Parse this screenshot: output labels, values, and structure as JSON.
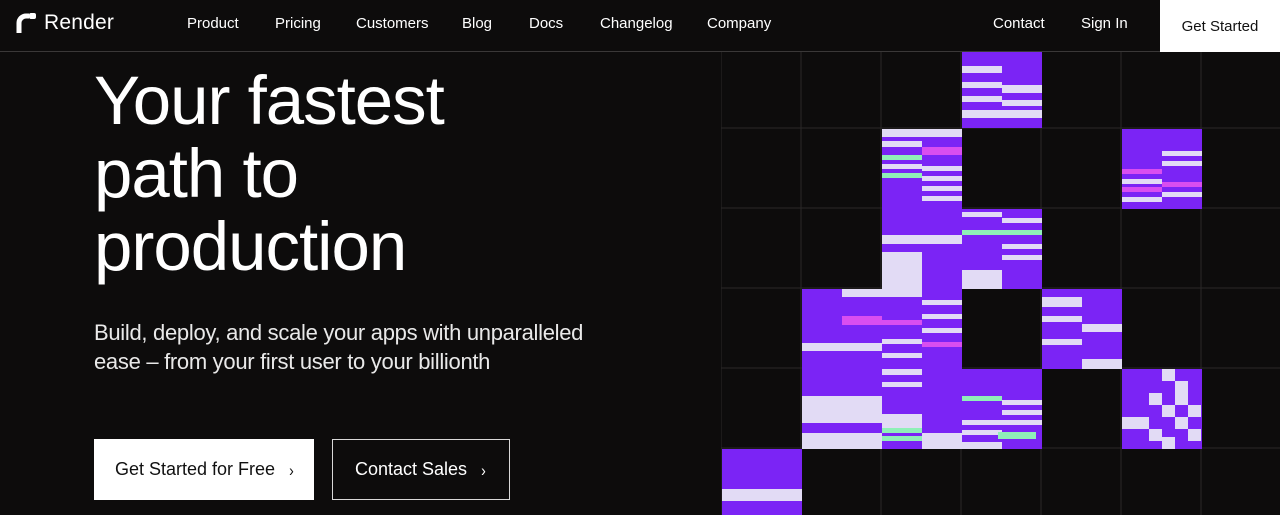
{
  "brand": {
    "name": "Render",
    "icon": "render-logo-icon"
  },
  "nav": {
    "items": [
      "Product",
      "Pricing",
      "Customers",
      "Blog",
      "Docs",
      "Changelog",
      "Company"
    ],
    "right": [
      "Contact",
      "Sign In"
    ],
    "cta": "Get Started"
  },
  "hero": {
    "title_lines": [
      "Your fastest",
      "path to",
      "production"
    ],
    "subtitle_lines": [
      "Build, deploy, and scale your apps with unparalleled",
      "ease – from your first user to your billionth"
    ],
    "primary_button": "Get Started for Free",
    "secondary_button": "Contact Sales"
  },
  "colors": {
    "background": "#0d0c0c",
    "purple": "#7b24f5",
    "lavender": "#e2dbf5",
    "mint": "#8ff0b8",
    "magenta": "#d94ef0",
    "grid_line": "#2a2828"
  }
}
